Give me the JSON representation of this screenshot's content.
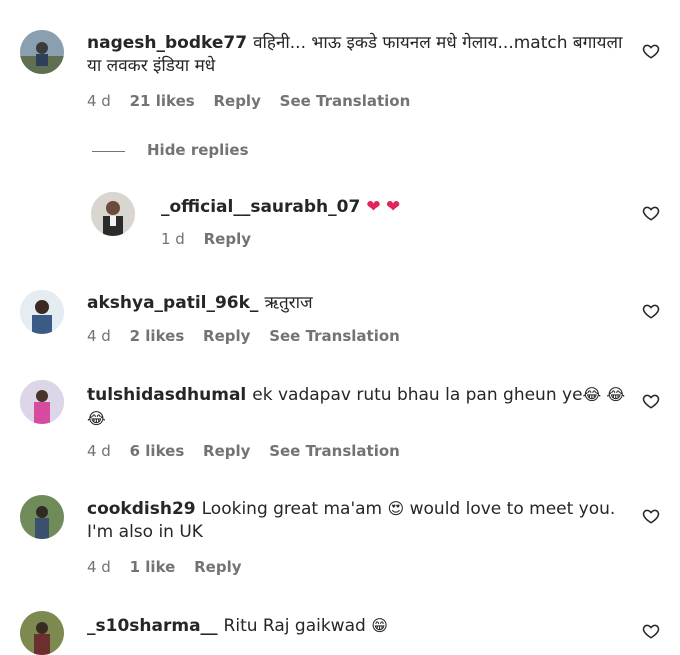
{
  "comments": [
    {
      "username": "nagesh_bodke77",
      "text": "वहिनी... भाऊ इकडे फायनल मधे गेलाय...match बगायला या लवकर इंडिया मधे",
      "time": "4 d",
      "likes": "21 likes",
      "reply": "Reply",
      "translation": "See Translation"
    },
    {
      "username": "akshya_patil_96k_",
      "text": "ऋतुराज",
      "time": "4 d",
      "likes": "2 likes",
      "reply": "Reply",
      "translation": "See Translation"
    },
    {
      "username": "tulshidasdhumal",
      "text": "ek vadapav rutu bhau la pan gheun ye",
      "time": "4 d",
      "likes": "6 likes",
      "reply": "Reply",
      "translation": "See Translation"
    },
    {
      "username": "cookdish29",
      "text_before": "Looking great ma'am",
      "text_after": "would love to meet you. I'm also in UK",
      "time": "4 d",
      "likes": "1 like",
      "reply": "Reply"
    },
    {
      "username": "_s10sharma__",
      "text": "Ritu Raj gaikwad"
    }
  ],
  "hide_replies": "Hide replies",
  "reply": {
    "username": "_official__saurabh_07",
    "time": "1 d",
    "reply": "Reply"
  },
  "icons": {
    "like": "heart-outline-icon"
  },
  "colors": {
    "text": "#262626",
    "muted": "#737373",
    "red_heart": "#e0245e"
  }
}
